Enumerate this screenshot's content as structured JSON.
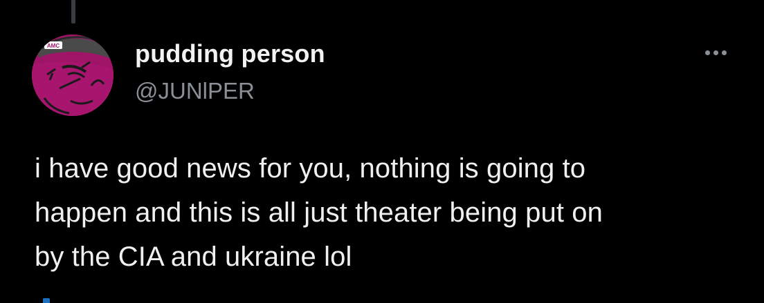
{
  "tweet": {
    "display_name": "pudding person",
    "handle": "@JUNlPER",
    "text": "i have good news for you, nothing is going to\nhappen and this is all just theater being put on\nby the CIA and ukraine lol"
  },
  "avatar": {
    "icon": "cartoon-face-with-cap-avatar",
    "cap_text": "AMC"
  },
  "actions": {
    "more_icon": "more-options-icon"
  },
  "colors": {
    "background": "#000000",
    "name": "#f2f2f2",
    "handle": "#8b9096",
    "avatar_fill": "#a01468",
    "thread_line": "#3a3d40"
  }
}
